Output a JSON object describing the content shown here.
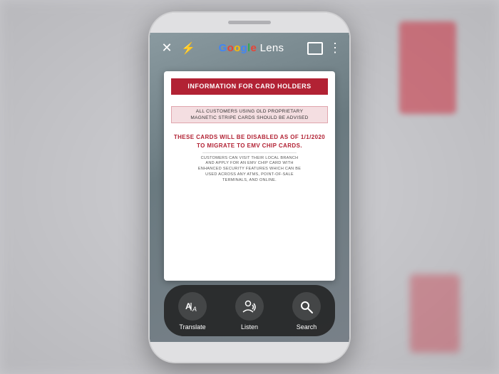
{
  "app": {
    "title_prefix": "Google",
    "title_lens": "Lens"
  },
  "topbar": {
    "close_icon": "✕",
    "flash_icon": "⚡",
    "more_icon": "⋮"
  },
  "card": {
    "header": "INFORMATION FOR\nCARD HOLDERS",
    "line1": "ALL CUSTOMERS USING OLD PROPRIETARY",
    "line2": "MAGNETIC STRIPE CARDS SHOULD BE ADVISED",
    "middle": "THESE CARDS WILL BE\nDISABLED AS OF\n1/1/2020 TO MIGRATE TO\nEMV CHIP CARDS.",
    "footer1": "CUSTOMERS CAN VISIT THEIR LOCAL BRANCH",
    "footer2": "AND APPLY FOR AN EMV CHIP CARD WITH",
    "footer3": "ENHANCED SECURITY FEATURES WHICH CAN BE",
    "footer4": "USED ACROSS ANY ATMS, POINT-OF-SALE",
    "footer5": "TERMINALS, AND ONLINE."
  },
  "actions": [
    {
      "id": "translate",
      "label": "Translate",
      "icon": "translate"
    },
    {
      "id": "listen",
      "label": "Listen",
      "icon": "listen"
    },
    {
      "id": "search",
      "label": "Search",
      "icon": "search"
    }
  ],
  "colors": {
    "brand_red": "#b22234",
    "google_blue": "#4285f4",
    "google_red": "#ea4335",
    "google_yellow": "#fbbc05",
    "google_green": "#34a853"
  }
}
